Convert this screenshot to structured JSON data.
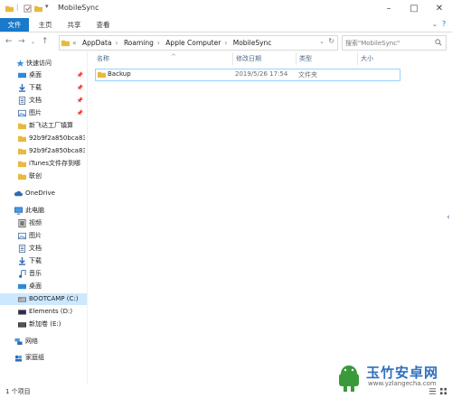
{
  "window": {
    "title": "MobileSync"
  },
  "ribbon": {
    "tabs": [
      "文件",
      "主页",
      "共享",
      "查看"
    ]
  },
  "navigation": {
    "breadcrumb_overflow": "«",
    "breadcrumbs": [
      "AppData",
      "Roaming",
      "Apple Computer",
      "MobileSync"
    ],
    "search_placeholder": "搜索\"MobileSync\""
  },
  "sidebar": {
    "quick_access": {
      "label": "快速访问",
      "items": [
        {
          "label": "桌面",
          "icon": "desktop-icon",
          "pinned": true
        },
        {
          "label": "下载",
          "icon": "download-icon",
          "pinned": true
        },
        {
          "label": "文档",
          "icon": "document-icon",
          "pinned": true
        },
        {
          "label": "图片",
          "icon": "picture-icon",
          "pinned": true
        },
        {
          "label": "新飞达工厂镇算",
          "icon": "folder-icon",
          "pinned": false
        },
        {
          "label": "92b9f2a850bca83",
          "icon": "folder-icon",
          "pinned": false
        },
        {
          "label": "92b9f2a850bca83",
          "icon": "folder-icon",
          "pinned": false
        },
        {
          "label": "iTunes文件存到哪",
          "icon": "folder-icon",
          "pinned": false
        },
        {
          "label": "联创",
          "icon": "folder-icon",
          "pinned": false
        }
      ]
    },
    "onedrive": {
      "label": "OneDrive"
    },
    "this_pc": {
      "label": "此电脑",
      "items": [
        {
          "label": "视频",
          "icon": "video-icon"
        },
        {
          "label": "图片",
          "icon": "picture-icon"
        },
        {
          "label": "文档",
          "icon": "document-icon"
        },
        {
          "label": "下载",
          "icon": "download-icon"
        },
        {
          "label": "音乐",
          "icon": "music-icon"
        },
        {
          "label": "桌面",
          "icon": "desktop-icon"
        },
        {
          "label": "BOOTCAMP (C:)",
          "icon": "drive-icon"
        },
        {
          "label": "Elements (D:)",
          "icon": "drive-icon"
        },
        {
          "label": "新加卷 (E:)",
          "icon": "drive-icon"
        }
      ]
    },
    "network": {
      "label": "网络"
    },
    "homegroup": {
      "label": "家庭组"
    }
  },
  "file_list": {
    "columns": [
      "名称",
      "修改日期",
      "类型",
      "大小"
    ],
    "rows": [
      {
        "name": "Backup",
        "modified": "2019/5/26 17:54",
        "type": "文件夹",
        "size": ""
      }
    ]
  },
  "status": {
    "item_count": "1 个项目"
  },
  "watermark": {
    "brand": "玉竹安卓网",
    "url": "www.yzlangecha.com"
  },
  "colors": {
    "accent": "#1979ca",
    "selection": "#cce8ff",
    "folder": "#e8b93e"
  }
}
